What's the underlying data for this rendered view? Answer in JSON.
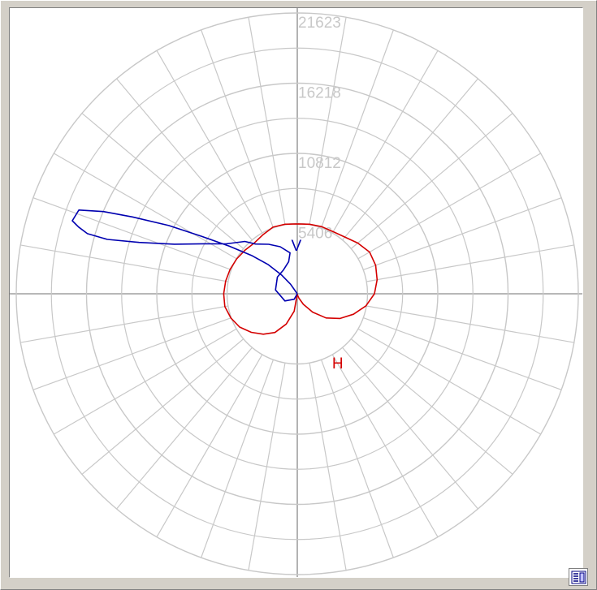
{
  "chart_data": {
    "type": "polar",
    "rings": [
      5406,
      10812,
      16218,
      21623
    ],
    "ring_labels": [
      "5406",
      "10812",
      "16218",
      "21623"
    ],
    "rmax": 21623,
    "angle_step_deg": 10,
    "grid": true,
    "grid_color": "#c8c8c8",
    "axis_color": "#a0a0a0",
    "series": [
      {
        "name": "H",
        "color": "#d40000",
        "label_value": {
          "angle_deg": 25,
          "r": 6350
        },
        "points": [
          [
            0,
            0
          ],
          [
            -10,
            1360
          ],
          [
            -20,
            2480
          ],
          [
            -30,
            3440
          ],
          [
            -40,
            4060
          ],
          [
            -50,
            4620
          ],
          [
            -60,
            5120
          ],
          [
            -70,
            5440
          ],
          [
            -80,
            5660
          ],
          [
            -90,
            5660
          ],
          [
            -100,
            5600
          ],
          [
            -110,
            5500
          ],
          [
            -120,
            5380
          ],
          [
            -130,
            5240
          ],
          [
            -140,
            5120
          ],
          [
            -150,
            5260
          ],
          [
            -160,
            5460
          ],
          [
            -170,
            5440
          ],
          [
            180,
            5380
          ],
          [
            170,
            5440
          ],
          [
            160,
            5500
          ],
          [
            150,
            5520
          ],
          [
            140,
            5700
          ],
          [
            130,
            6080
          ],
          [
            120,
            6420
          ],
          [
            110,
            6420
          ],
          [
            100,
            6240
          ],
          [
            90,
            5940
          ],
          [
            80,
            5360
          ],
          [
            70,
            4600
          ],
          [
            60,
            3800
          ],
          [
            50,
            2900
          ],
          [
            40,
            1840
          ],
          [
            30,
            940
          ],
          [
            20,
            360
          ],
          [
            10,
            100
          ],
          [
            0,
            0
          ]
        ]
      },
      {
        "name": "V",
        "color": "#0000b0",
        "label_value": {
          "angle_deg": -172,
          "r": 3350
        },
        "points": [
          [
            0,
            0
          ],
          [
            -30,
            480
          ],
          [
            -60,
            1100
          ],
          [
            -100,
            1700
          ],
          [
            -130,
            2000
          ],
          [
            -150,
            2120
          ],
          [
            -165,
            2560
          ],
          [
            -170,
            3200
          ],
          [
            -160,
            3860
          ],
          [
            -150,
            4400
          ],
          [
            -140,
            5000
          ],
          [
            -135,
            5700
          ],
          [
            -125,
            6700
          ],
          [
            -118,
            8200
          ],
          [
            -112,
            10200
          ],
          [
            -108,
            12800
          ],
          [
            -106,
            15200
          ],
          [
            -106,
            16800
          ],
          [
            -107,
            17600
          ],
          [
            -108,
            18200
          ],
          [
            -111,
            18000
          ],
          [
            -113,
            16200
          ],
          [
            -115,
            14000
          ],
          [
            -118,
            11200
          ],
          [
            -121,
            8600
          ],
          [
            -125,
            6400
          ],
          [
            -130,
            4600
          ],
          [
            -135,
            3200
          ],
          [
            -140,
            1900
          ],
          [
            -145,
            900
          ],
          [
            0,
            0
          ]
        ]
      }
    ]
  },
  "icon": "settings-page-icon"
}
